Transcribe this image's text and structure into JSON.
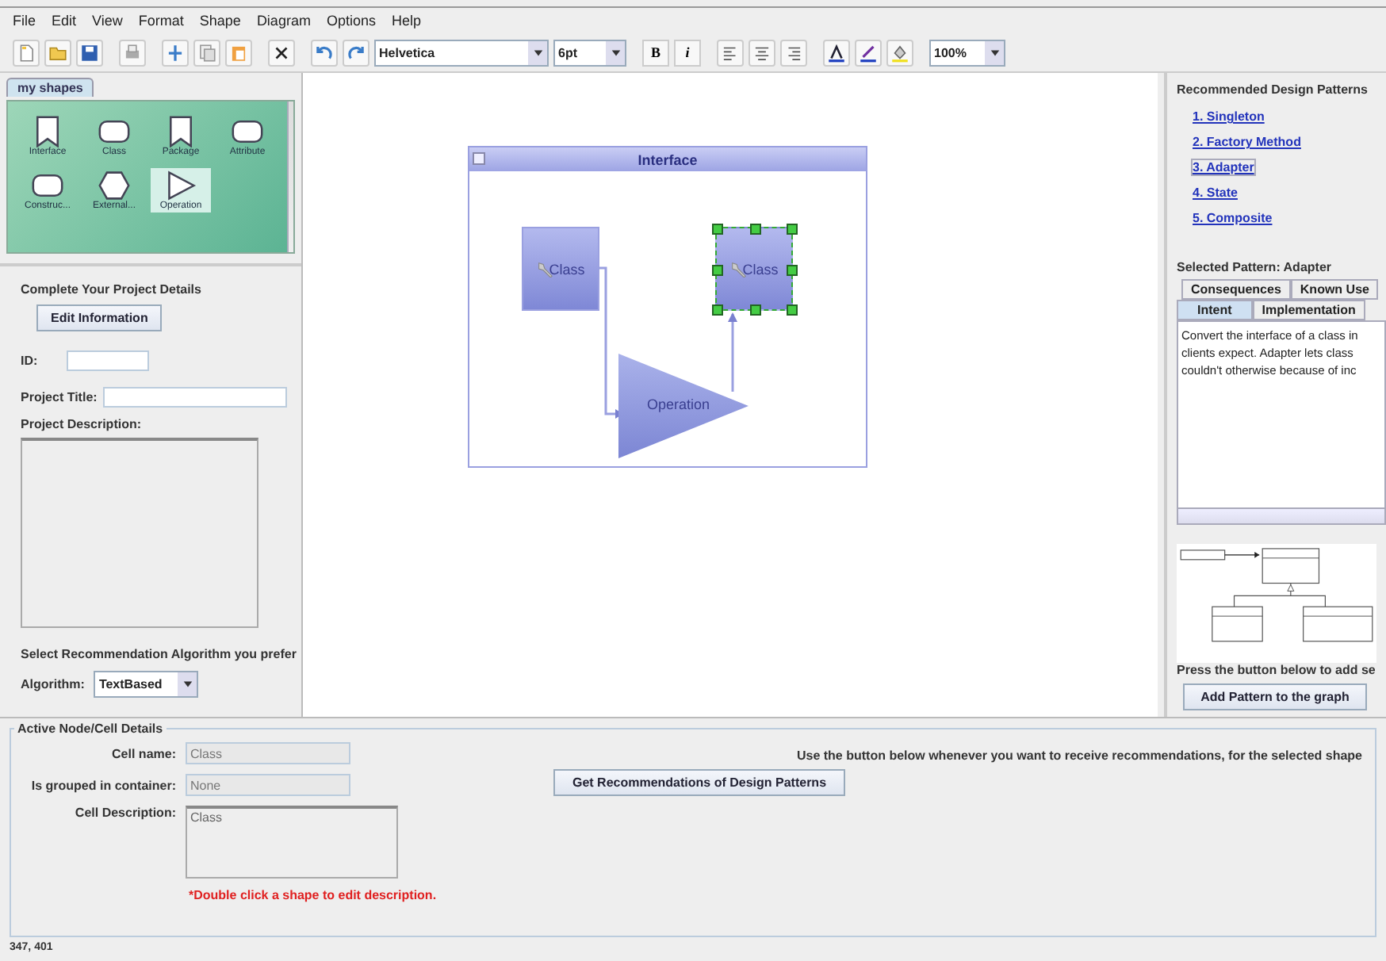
{
  "menu": [
    "File",
    "Edit",
    "View",
    "Format",
    "Shape",
    "Diagram",
    "Options",
    "Help"
  ],
  "toolbar": {
    "font": "Helvetica",
    "size": "6pt",
    "bold": "B",
    "italic": "i",
    "zoom": "100%"
  },
  "palette": {
    "tab": "my shapes",
    "items": [
      {
        "label": "Interface",
        "kind": "notched",
        "selected": false
      },
      {
        "label": "Class",
        "kind": "rounded",
        "selected": false
      },
      {
        "label": "Package",
        "kind": "notched",
        "selected": false
      },
      {
        "label": "Attribute",
        "kind": "rounded",
        "selected": false
      },
      {
        "label": "Construc...",
        "kind": "rounded",
        "selected": false
      },
      {
        "label": "External...",
        "kind": "hexagon",
        "selected": false
      },
      {
        "label": "Operation",
        "kind": "triangle",
        "selected": true
      }
    ]
  },
  "project": {
    "heading": "Complete Your Project Details",
    "edit_button": "Edit Information",
    "id_label": "ID:",
    "title_label": "Project Title:",
    "description_label": "Project Description:",
    "algorithm_heading": "Select Recommendation Algorithm you prefer",
    "algorithm_label": "Algorithm:",
    "algorithm": "TextBased"
  },
  "canvas": {
    "container_title": "Interface",
    "nodes": [
      {
        "label": "Class",
        "kind": "class",
        "selected": false
      },
      {
        "label": "Class",
        "kind": "class",
        "selected": true
      },
      {
        "label": "Operation",
        "kind": "operation",
        "selected": false
      }
    ]
  },
  "recommendations": {
    "heading": "Recommended Design Patterns",
    "patterns": [
      {
        "label": "1. Singleton",
        "selected": false
      },
      {
        "label": "2. Factory Method",
        "selected": false
      },
      {
        "label": "3. Adapter",
        "selected": true
      },
      {
        "label": "4. State",
        "selected": false
      },
      {
        "label": "5. Composite",
        "selected": false
      }
    ],
    "selected_pattern": "Selected Pattern: Adapter",
    "tab_rows": [
      [
        {
          "label": "Consequences",
          "selected": false
        },
        {
          "label": "Known Use",
          "selected": false
        }
      ],
      [
        {
          "label": "Intent",
          "selected": true
        },
        {
          "label": "Implementation",
          "selected": false
        }
      ]
    ],
    "text_lines": [
      "Convert the interface of a class in",
      "clients expect. Adapter lets class",
      "couldn't otherwise because of inc"
    ],
    "add_hint": "Press the button below to add se",
    "add_button": "Add Pattern to the graph"
  },
  "details": {
    "title": "Active Node/Cell Details",
    "cell_name_label": "Cell name:",
    "cell_name": "Class",
    "grouped_label": "Is grouped in container:",
    "grouped": "None",
    "description_label": "Cell Description:",
    "description": "Class",
    "hint": "*Double click a shape to edit description.",
    "recommend_text": "Use the button below whenever you want to receive recommendations, for the selected shape",
    "recommend_button": "Get Recommendations of Design Patterns"
  },
  "status_bar": "347, 401"
}
